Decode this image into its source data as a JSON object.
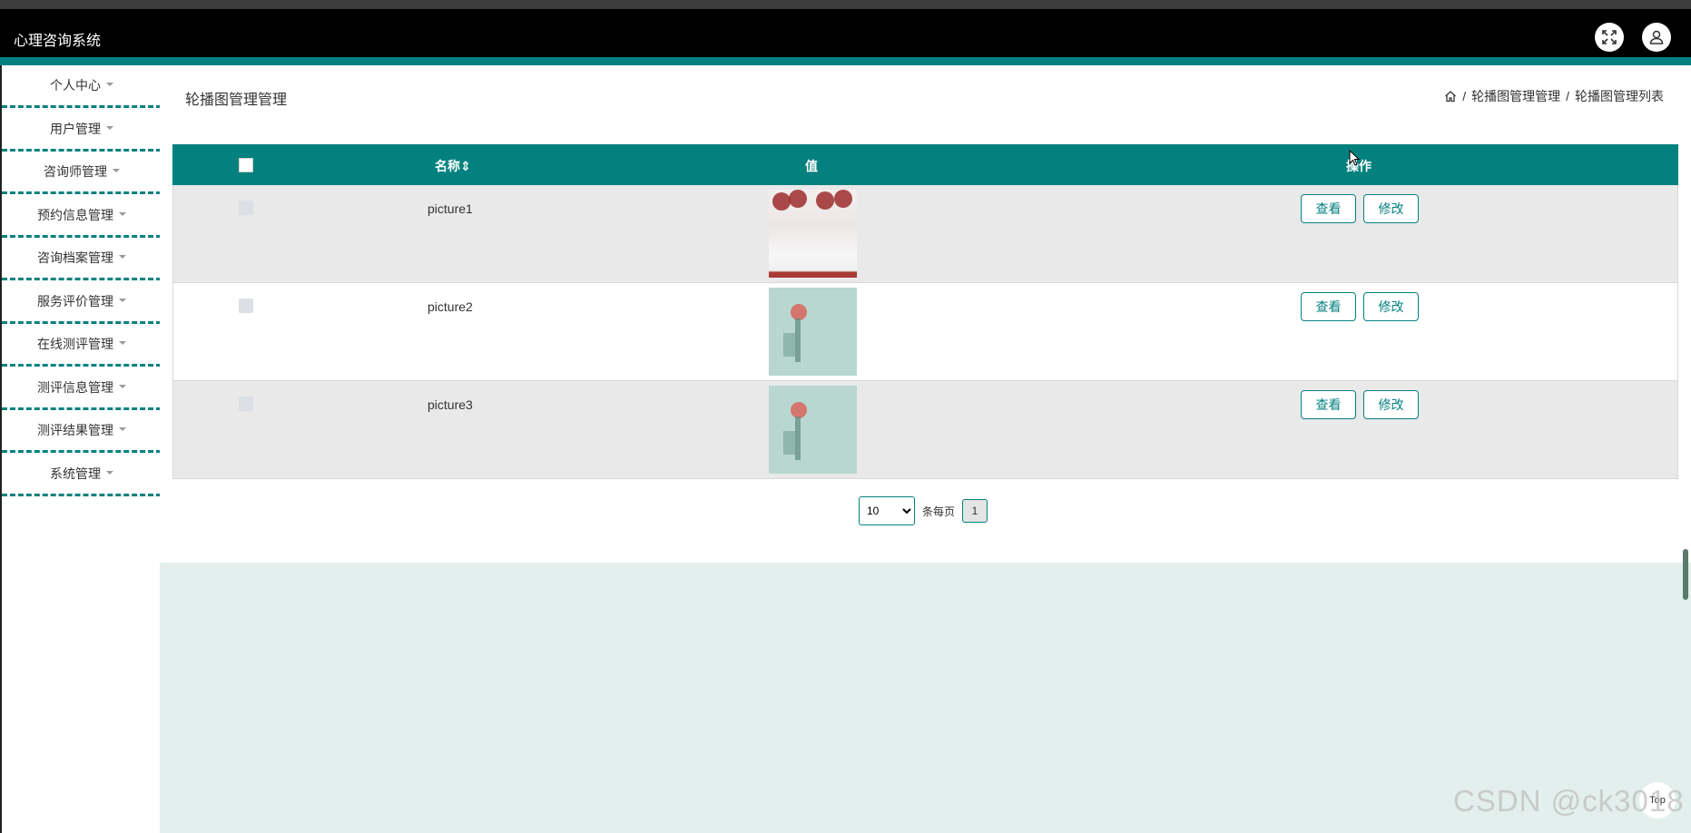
{
  "app": {
    "title": "心理咨询系统"
  },
  "header": {
    "fullscreen_icon": "expand-icon",
    "user_icon": "user-icon"
  },
  "sidebar": {
    "items": [
      {
        "label": "个人中心"
      },
      {
        "label": "用户管理"
      },
      {
        "label": "咨询师管理"
      },
      {
        "label": "预约信息管理"
      },
      {
        "label": "咨询档案管理"
      },
      {
        "label": "服务评价管理"
      },
      {
        "label": "在线测评管理"
      },
      {
        "label": "测评信息管理"
      },
      {
        "label": "测评结果管理"
      },
      {
        "label": "系统管理"
      }
    ]
  },
  "page": {
    "title": "轮播图管理管理",
    "breadcrumb": {
      "home_icon": "home-icon",
      "sep": "/",
      "level1": "轮播图管理管理",
      "level2": "轮播图管理列表"
    }
  },
  "table": {
    "columns": {
      "name": "名称",
      "sort": "⇕",
      "value": "值",
      "ops": "操作"
    },
    "rows": [
      {
        "name": "picture1",
        "view": "查看",
        "edit": "修改"
      },
      {
        "name": "picture2",
        "view": "查看",
        "edit": "修改"
      },
      {
        "name": "picture3",
        "view": "查看",
        "edit": "修改"
      }
    ]
  },
  "pagination": {
    "page_size": "10",
    "page_size_options": [
      "10"
    ],
    "per_page_label": "条每页",
    "current_page": "1"
  },
  "footer": {
    "top_label": "Top",
    "watermark": "CSDN @ck3018"
  },
  "colors": {
    "accent": "#04817f",
    "topbar": "#000000",
    "background": "#e3efec"
  }
}
